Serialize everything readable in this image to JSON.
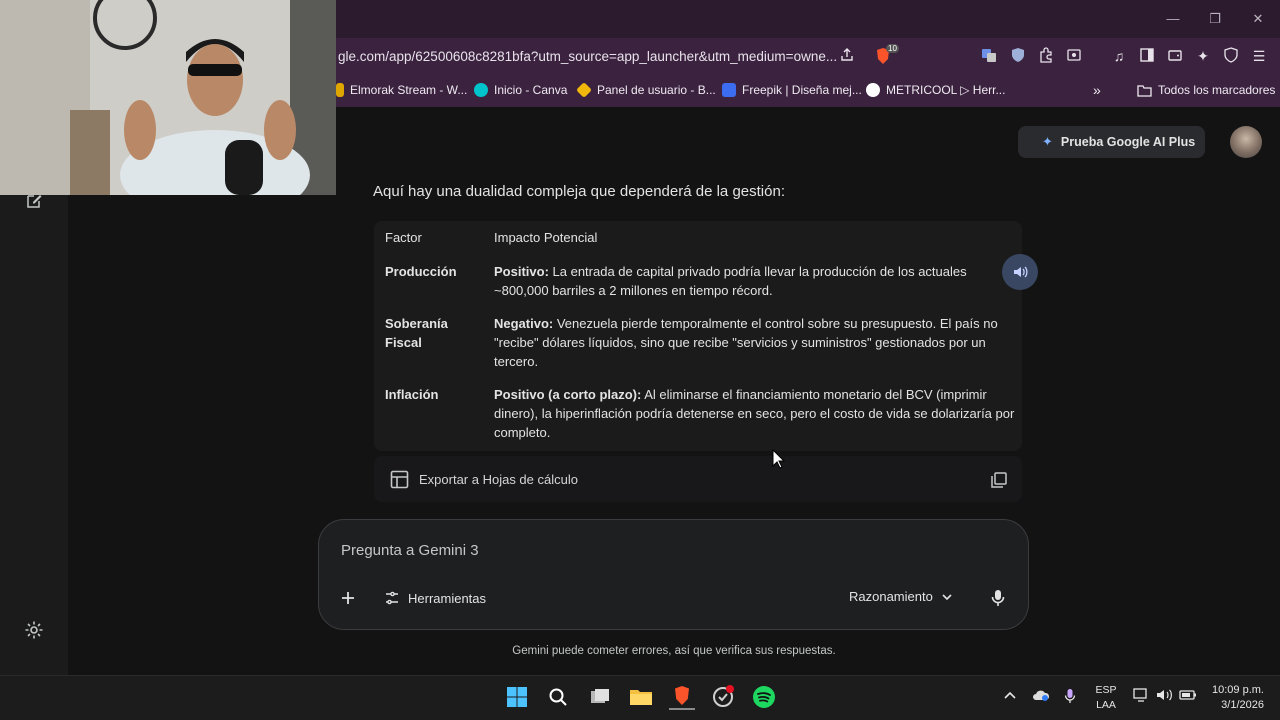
{
  "browser": {
    "url": "gle.com/app/62500608c8281bfa?utm_source=app_launcher&utm_medium=owne...",
    "brave_badge": "10",
    "bookmarks": [
      {
        "label": "Elmorak Stream - W...",
        "icon": "generic-bookmark-icon",
        "color": "#e0a600"
      },
      {
        "label": "Inicio - Canva",
        "icon": "canva-icon",
        "color": "#00c4cc"
      },
      {
        "label": "Panel de usuario - B...",
        "icon": "binance-icon",
        "color": "#f0b90b"
      },
      {
        "label": "Freepik | Diseña mej...",
        "icon": "freepik-icon",
        "color": "#3c6cf0"
      },
      {
        "label": "METRICOOL ▷ Herr...",
        "icon": "metricool-icon",
        "color": "#ffffff"
      }
    ],
    "bookmarks_overflow": "»",
    "all_bookmarks": "Todos los marcadores"
  },
  "header": {
    "ai_plus_label": "Prueba Google AI Plus"
  },
  "response": {
    "intro": "Aquí hay una dualidad compleja que dependerá de la gestión:",
    "table": {
      "headers": [
        "Factor",
        "Impacto Potencial"
      ],
      "rows": [
        {
          "factor": "Producción",
          "impact_bold": "Positivo:",
          "impact_text": " La entrada de capital privado podría llevar la producción de los actuales ~800,000 barriles a 2 millones en tiempo récord."
        },
        {
          "factor": "Soberanía Fiscal",
          "impact_bold": "Negativo:",
          "impact_text": " Venezuela pierde temporalmente el control sobre su presupuesto. El país no \"recibe\" dólares líquidos, sino que recibe \"servicios y suministros\" gestionados por un tercero."
        },
        {
          "factor": "Inflación",
          "impact_bold": "Positivo (a corto plazo):",
          "impact_text": " Al eliminarse el financiamiento monetario del BCV (imprimir dinero), la hiperinflación podría detenerse en seco, pero el costo de vida se dolarizaría por completo."
        }
      ]
    },
    "export_label": "Exportar a Hojas de cálculo"
  },
  "prompt": {
    "placeholder": "Pregunta a Gemini 3",
    "tools_label": "Herramientas",
    "mode_label": "Razonamiento"
  },
  "disclaimer": "Gemini puede cometer errores, así que verifica sus respuestas.",
  "taskbar": {
    "lang_line1": "ESP",
    "lang_line2": "LAA",
    "time": "10:09 p.m.",
    "date": "3/1/2026"
  },
  "colors": {
    "accent": "#a8c7fa",
    "titlebar": "#2c1b2f",
    "toolbar": "#3b2340",
    "background": "#131314"
  }
}
